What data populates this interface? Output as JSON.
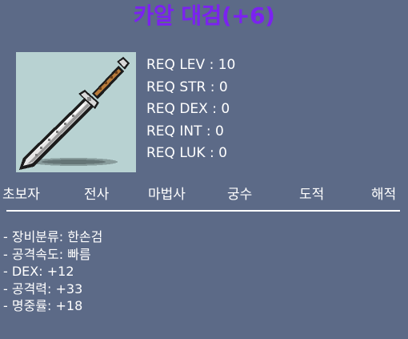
{
  "item": {
    "name": "카알 대검(+6)",
    "name_color": "#7b22f0",
    "icon": "dagger-icon"
  },
  "requirements": [
    "REQ LEV : 10",
    "REQ STR : 0",
    "REQ DEX : 0",
    "REQ INT : 0",
    "REQ LUK : 0"
  ],
  "jobs": [
    "초보자",
    "전사",
    "마법사",
    "궁수",
    "도적",
    "해적"
  ],
  "stats": [
    "- 장비분류: 한손검",
    "- 공격속도: 빠름",
    "- DEX: +12",
    "- 공격력: +33",
    "- 명중률: +18"
  ],
  "colors": {
    "background": "#5c6a87",
    "icon_background": "#b8d2d2",
    "text": "#ffffff"
  }
}
